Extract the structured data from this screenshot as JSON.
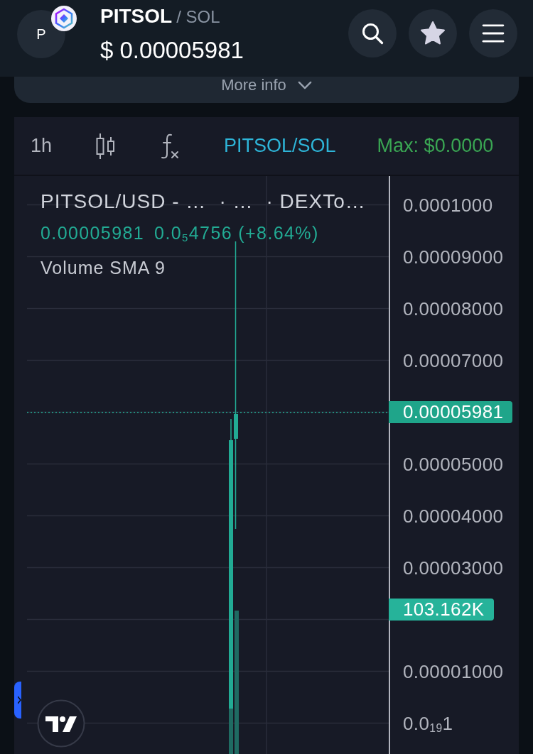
{
  "header": {
    "avatar_letter": "P",
    "base_symbol": "PITSOL",
    "quote_label": "/ SOL",
    "price": "$ 0.00005981",
    "actions": [
      {
        "kind": "search"
      },
      {
        "kind": "favorite"
      },
      {
        "kind": "menu"
      }
    ]
  },
  "more_info": {
    "label": "More info"
  },
  "chart": {
    "toolbar": {
      "interval": "1h",
      "tools": [
        {
          "kind": "candles"
        },
        {
          "kind": "indicators"
        }
      ],
      "pair": "PITSOL/SOL",
      "max": "Max: $0.0000"
    },
    "legend": {
      "title_parts": [
        "PITSOL/USD - …",
        "· …",
        "· DEXTo…"
      ],
      "price": "0.00005981",
      "change": "0.0$_{5}$4756 (+8.64%)",
      "indicator": "Volume SMA 9"
    },
    "price_axis": [
      {
        "kind": "label",
        "text": "0.0001000"
      },
      {
        "kind": "label",
        "text": "0.00009000"
      },
      {
        "kind": "label",
        "text": "0.00008000"
      },
      {
        "kind": "label",
        "text": "0.00007000"
      },
      {
        "kind": "price-tag",
        "text": "0.00005981"
      },
      {
        "kind": "label",
        "text": "0.00005000"
      },
      {
        "kind": "label",
        "text": "0.00004000"
      },
      {
        "kind": "label",
        "text": "0.00003000"
      },
      {
        "kind": "volume-tag",
        "text": "103.162K"
      },
      {
        "kind": "label",
        "text": "0.00001000"
      },
      {
        "kind": "label",
        "text": "0.0$_{19}$1"
      }
    ]
  }
}
